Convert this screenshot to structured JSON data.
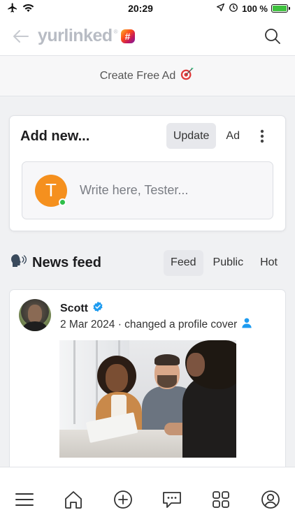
{
  "status_bar": {
    "time": "20:29",
    "battery_percent": "100 %",
    "battery_level": 1.0,
    "icons": [
      "airplane-icon",
      "wifi-icon",
      "location-icon",
      "alarm-icon",
      "battery-icon"
    ]
  },
  "header": {
    "logo_text": "yurlinked",
    "logo_registered": "®",
    "logo_badge": "#",
    "icons": [
      "back-arrow-icon",
      "search-icon"
    ]
  },
  "ad_banner": {
    "label": "Create Free Ad",
    "icon": "target-icon"
  },
  "add_new": {
    "title": "Add new...",
    "tabs": [
      {
        "label": "Update",
        "active": true
      },
      {
        "label": "Ad",
        "active": false
      }
    ],
    "avatar_letter": "T",
    "placeholder": "Write here, Tester..."
  },
  "feed": {
    "title": "News feed",
    "icon": "speaking-head-icon",
    "tabs": [
      {
        "label": "Feed",
        "active": true
      },
      {
        "label": "Public",
        "active": false
      },
      {
        "label": "Hot",
        "active": false
      }
    ]
  },
  "post": {
    "author": "Scott",
    "verified": true,
    "meta": "2 Mar 2024 · changed a profile cover"
  },
  "bottom_nav": [
    "menu-icon",
    "home-icon",
    "add-icon",
    "chat-icon",
    "apps-icon",
    "profile-icon"
  ],
  "colors": {
    "accent_orange": "#f5901e",
    "online_green": "#2fbf4a",
    "verified_blue": "#1d9bf0",
    "battery_green": "#3ec23e"
  }
}
